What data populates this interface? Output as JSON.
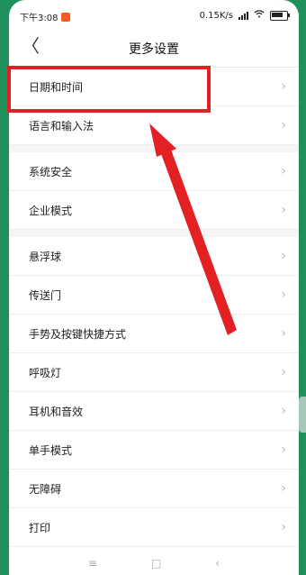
{
  "status": {
    "time": "下午3:08",
    "speed": "0.15K/s"
  },
  "header": {
    "title": "更多设置",
    "back_glyph": "〈"
  },
  "groups": [
    [
      "日期和时间",
      "语言和输入法"
    ],
    [
      "系统安全",
      "企业模式"
    ],
    [
      "悬浮球",
      "传送门",
      "手势及按键快捷方式",
      "呼吸灯",
      "耳机和音效",
      "单手模式",
      "无障碍",
      "打印"
    ]
  ],
  "chevron": "›",
  "nav": {
    "menu": "≡",
    "home": "□",
    "back": "‹"
  },
  "colors": {
    "annotation_red": "#e32124",
    "background_green": "#1f8f5c"
  },
  "icons": [
    "back-icon",
    "chevron-right-icon",
    "wifi-icon",
    "battery-icon",
    "signal-icon"
  ]
}
